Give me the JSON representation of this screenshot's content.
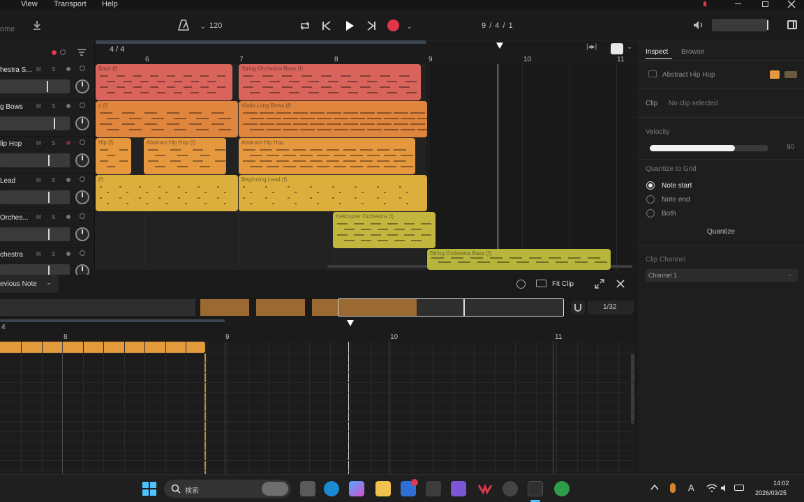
{
  "menu": [
    "View",
    "Transport",
    "Help"
  ],
  "toolbar": {
    "tempo": "120",
    "position": "9 / 4 / 1",
    "left_label": "ome"
  },
  "arrangement": {
    "time_signature": "4 / 4",
    "bars": [
      "6",
      "7",
      "8",
      "9",
      "10",
      "11"
    ],
    "tracks": [
      {
        "name": "hestra S...",
        "m": "M",
        "s": "S",
        "fader": 0.67
      },
      {
        "name": "g Bows",
        "m": "M",
        "s": "S",
        "fader": 0.77
      },
      {
        "name": "lip Hop",
        "m": "M",
        "s": "S",
        "fader": 0.69
      },
      {
        "name": "Lead",
        "m": "M",
        "s": "S",
        "fader": 0.69
      },
      {
        "name": "Orches...",
        "m": "M",
        "s": "S",
        "fader": 0.69
      },
      {
        "name": "chestra",
        "m": "M",
        "s": "S",
        "fader": 0.69
      }
    ],
    "clips": [
      {
        "label": "Bass (f)",
        "color": "#d9645b"
      },
      {
        "label": "String Orchestra Bass (f)",
        "color": "#d9645b"
      },
      {
        "label": "s (f)",
        "color": "#e0853e"
      },
      {
        "label": "Violin Long Bows (f)",
        "color": "#e0853e"
      },
      {
        "label": "Hip (f)",
        "color": "#e5983e"
      },
      {
        "label": "Abstract Hip Hop (f)",
        "color": "#e5983e"
      },
      {
        "label": "Abstract Hip Hop",
        "color": "#e5983e"
      },
      {
        "label": "(f)",
        "color": "#dcae3c"
      },
      {
        "label": "Beginning Lead (f)",
        "color": "#dcae3c"
      },
      {
        "label": "Helicopter Orchestra (f)",
        "color": "#c4b53e"
      },
      {
        "label": "String Orchestra Bass (f)",
        "color": "#b7b53c"
      }
    ]
  },
  "inspector": {
    "tabs": [
      "Inspect",
      "Browse"
    ],
    "track_name": "Abstract Hip Hop",
    "clip_label": "Clip",
    "clip_value": "No clip selected",
    "velocity_label": "Velocity",
    "velocity_value": "90",
    "velocity_level": 0.9,
    "quantize_label": "Quantize to Grid",
    "options": [
      "Note start",
      "Note end",
      "Both"
    ],
    "quantize_button": "Quantize",
    "channel_label": "Clip Channel",
    "channel_value": "Channel 1"
  },
  "editor": {
    "previous_note": "evious Note",
    "fit_clip": "Fit Clip",
    "grid": "1/32",
    "bars": [
      "4",
      "8",
      "9",
      "10",
      "11"
    ]
  },
  "taskbar": {
    "search_placeholder": "検索",
    "time": "14:02",
    "date": "2026/03/25"
  },
  "colors": {
    "accent_red": "#e0374a",
    "clip_red": "#d9645b",
    "clip_orange": "#e0853e",
    "clip_amber": "#e5983e",
    "clip_yellow": "#dcae3c",
    "clip_lime": "#b7b53c"
  }
}
